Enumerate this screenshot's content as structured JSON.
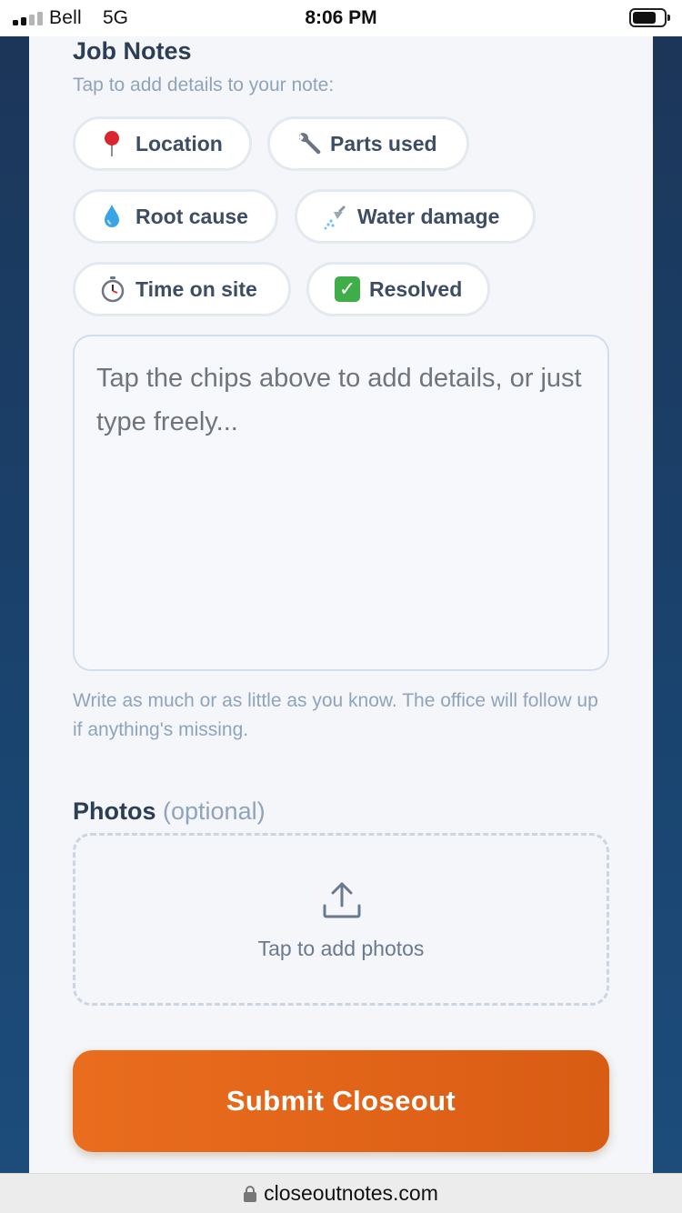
{
  "status_bar": {
    "carrier": "Bell",
    "network": "5G",
    "time": "8:06 PM",
    "signal_bars_active": 2,
    "signal_bars_total": 4,
    "battery_level": 0.75
  },
  "notes": {
    "title": "Job Notes",
    "hint": "Tap to add details to your note:",
    "chips": [
      {
        "label": "Location",
        "icon": "pushpin-icon"
      },
      {
        "label": "Parts used",
        "icon": "wrench-icon"
      },
      {
        "label": "Root cause",
        "icon": "droplet-icon"
      },
      {
        "label": "Water damage",
        "icon": "shower-icon"
      },
      {
        "label": "Time on site",
        "icon": "stopwatch-icon"
      },
      {
        "label": "Resolved",
        "icon": "check-mark-icon"
      }
    ],
    "textarea_placeholder": "Tap the chips above to add details, or just type freely...",
    "textarea_value": "",
    "helper": "Write as much or as little as you know. The office will follow up if anything's missing."
  },
  "photos": {
    "title": "Photos",
    "optional": "(optional)",
    "dropzone_label": "Tap to add photos",
    "icon": "upload-icon"
  },
  "submit_label": "Submit Closeout",
  "browser": {
    "url": "closeoutnotes.com"
  },
  "colors": {
    "accent": "#e2651a",
    "heading": "#2c3e56",
    "muted": "#8fa4bb",
    "background": "#1c3558",
    "card": "#f4f6f9"
  }
}
